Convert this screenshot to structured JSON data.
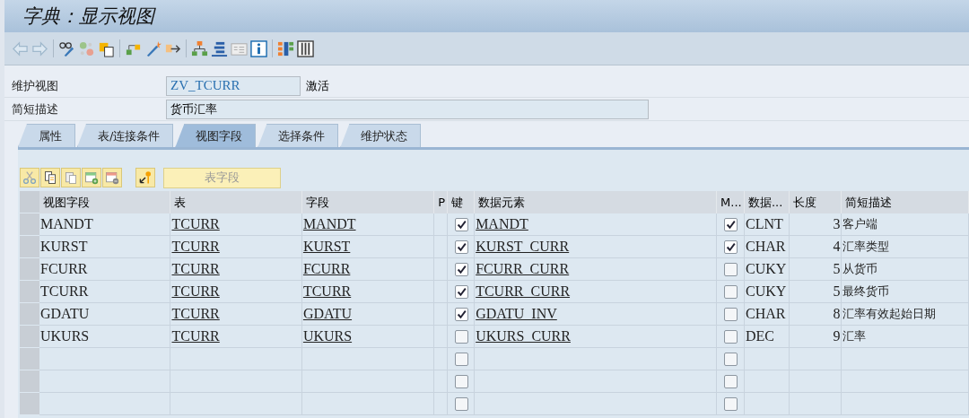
{
  "window": {
    "title": "字典：显示视图"
  },
  "form": {
    "view_label": "维护视图",
    "view_value": "ZV_TCURR",
    "view_status": "激活",
    "desc_label": "简短描述",
    "desc_value": "货币汇率"
  },
  "tabs": [
    {
      "label": "属性",
      "selected": false
    },
    {
      "label": "表/连接条件",
      "selected": false
    },
    {
      "label": "视图字段",
      "selected": true
    },
    {
      "label": "选择条件",
      "selected": false
    },
    {
      "label": "维护状态",
      "selected": false
    }
  ],
  "table_toolbar": {
    "table_fields_button": "表字段",
    "table_fields_disabled": true
  },
  "table": {
    "columns": [
      "视图字段",
      "表",
      "字段",
      "P",
      "键",
      "数据元素",
      "M...",
      "数据...",
      "长度",
      "简短描述"
    ],
    "rows": [
      {
        "view_field": "MANDT",
        "table": "TCURR",
        "field": "MANDT",
        "key": true,
        "data_element": "MANDT",
        "m": true,
        "data_type": "CLNT",
        "length": "3",
        "description": "客户端"
      },
      {
        "view_field": "KURST",
        "table": "TCURR",
        "field": "KURST",
        "key": true,
        "data_element": "KURST_CURR",
        "m": true,
        "data_type": "CHAR",
        "length": "4",
        "description": "汇率类型"
      },
      {
        "view_field": "FCURR",
        "table": "TCURR",
        "field": "FCURR",
        "key": true,
        "data_element": "FCURR_CURR",
        "m": false,
        "data_type": "CUKY",
        "length": "5",
        "description": "从货币"
      },
      {
        "view_field": "TCURR",
        "table": "TCURR",
        "field": "TCURR",
        "key": true,
        "data_element": "TCURR_CURR",
        "m": false,
        "data_type": "CUKY",
        "length": "5",
        "description": "最终货币"
      },
      {
        "view_field": "GDATU",
        "table": "TCURR",
        "field": "GDATU",
        "key": true,
        "data_element": "GDATU_INV",
        "m": false,
        "data_type": "CHAR",
        "length": "8",
        "description": "汇率有效起始日期"
      },
      {
        "view_field": "UKURS",
        "table": "TCURR",
        "field": "UKURS",
        "key": false,
        "data_element": "UKURS_CURR",
        "m": false,
        "data_type": "DEC",
        "length": "9",
        "description": "汇率"
      },
      {
        "key": false,
        "m": false
      },
      {
        "key": false,
        "m": false
      },
      {
        "key": false,
        "m": false
      }
    ]
  }
}
